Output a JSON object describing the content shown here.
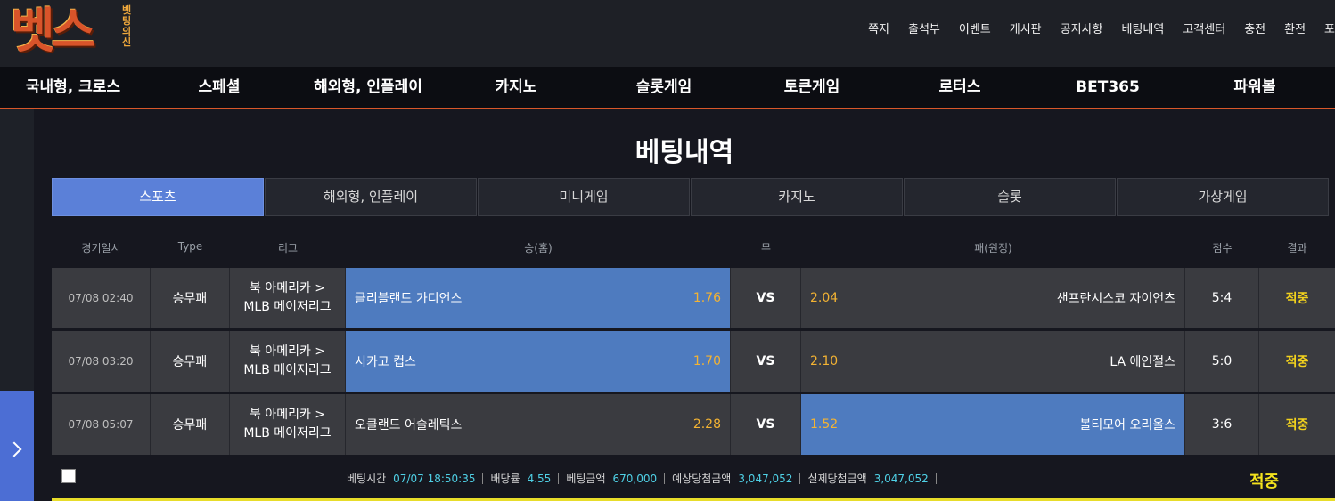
{
  "logo": {
    "main": "벳스",
    "sub": "벳팅의신"
  },
  "top_nav": [
    "쪽지",
    "출석부",
    "이벤트",
    "게시판",
    "공지사항",
    "베팅내역",
    "고객센터",
    "충전",
    "환전",
    "포"
  ],
  "main_nav": [
    "국내형, 크로스",
    "스페셜",
    "해외형, 인플레이",
    "카지노",
    "슬롯게임",
    "토큰게임",
    "로터스",
    "BET365",
    "파워볼"
  ],
  "page_title": "베팅내역",
  "tabs": [
    {
      "label": "스포츠",
      "active": true
    },
    {
      "label": "해외형, 인플레이",
      "active": false
    },
    {
      "label": "미니게임",
      "active": false
    },
    {
      "label": "카지노",
      "active": false
    },
    {
      "label": "슬롯",
      "active": false
    },
    {
      "label": "가상게임",
      "active": false
    }
  ],
  "columns": [
    "경기일시",
    "Type",
    "리그",
    "승(홈)",
    "무",
    "패(원정)",
    "점수",
    "결과"
  ],
  "rows": [
    {
      "date": "07/08 02:40",
      "type": "승무패",
      "league_1": "북 아메리카 >",
      "league_2": "MLB 메이저리그",
      "home": "클리블랜드 가디언스",
      "home_odds": "1.76",
      "draw": "VS",
      "away_odds": "2.04",
      "away": "샌프란시스코 자이언츠",
      "score": "5:4",
      "result": "적중",
      "winner": "home"
    },
    {
      "date": "07/08 03:20",
      "type": "승무패",
      "league_1": "북 아메리카 >",
      "league_2": "MLB 메이저리그",
      "home": "시카고 컵스",
      "home_odds": "1.70",
      "draw": "VS",
      "away_odds": "2.10",
      "away": "LA 에인절스",
      "score": "5:0",
      "result": "적중",
      "winner": "home"
    },
    {
      "date": "07/08 05:07",
      "type": "승무패",
      "league_1": "북 아메리카 >",
      "league_2": "MLB 메이저리그",
      "home": "오클랜드 어슬레틱스",
      "home_odds": "2.28",
      "draw": "VS",
      "away_odds": "1.52",
      "away": "볼티모어 오리올스",
      "score": "3:6",
      "result": "적중",
      "winner": "away"
    }
  ],
  "summary": {
    "bet_time_label": "베팅시간",
    "bet_time": "07/07 18:50:35",
    "odds_label": "배당률",
    "odds": "4.55",
    "amount_label": "베팅금액",
    "amount": "670,000",
    "expected_label": "예상당첨금액",
    "expected": "3,047,052",
    "actual_label": "실제당첨금액",
    "actual": "3,047,052",
    "result": "적중"
  },
  "colors": {
    "accent": "#5b80d8",
    "win_cell": "#4e7bbf",
    "odds": "#f3b333",
    "result": "#f3d21d",
    "nav_border": "#d8572a"
  }
}
